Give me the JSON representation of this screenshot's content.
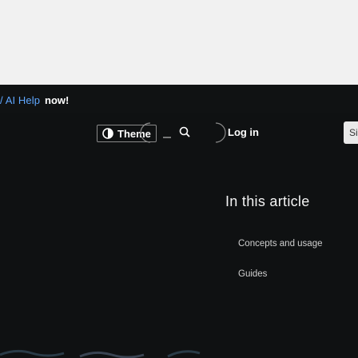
{
  "banner": {
    "prefix": "/ AI Help",
    "emphasis": "now!"
  },
  "toolbar": {
    "theme_label": "Theme",
    "theme_icon": "theme-toggle-icon",
    "search_icon": "search-icon",
    "login_label": "Log in",
    "cut_button_label": "Si"
  },
  "article": {
    "heading": "In this article",
    "toc": [
      "Concepts and usage",
      "Guides"
    ]
  },
  "colors": {
    "page_background": "#0f1112",
    "top_area": "#f1f1f1",
    "link_blue": "#5fa7ff"
  }
}
